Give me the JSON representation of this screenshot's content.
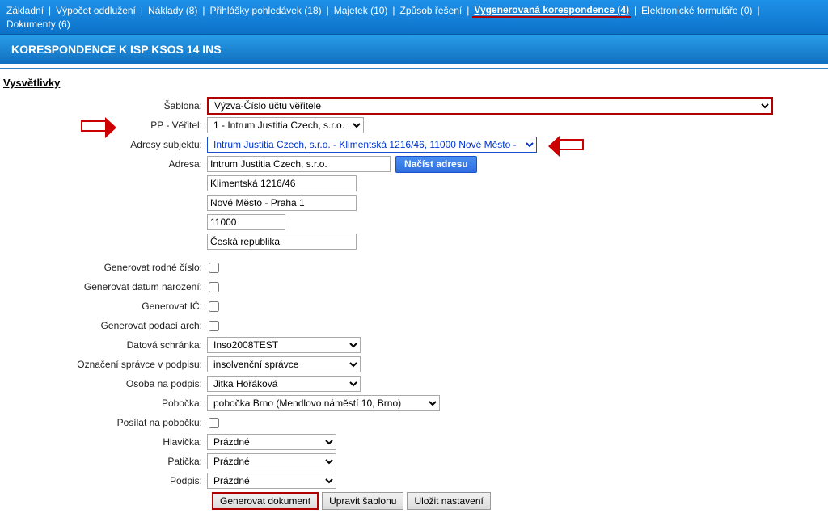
{
  "nav": {
    "items": [
      {
        "label": "Základní"
      },
      {
        "label": "Výpočet oddlužení"
      },
      {
        "label": "Náklady (8)"
      },
      {
        "label": "Přihlášky pohledávek (18)"
      },
      {
        "label": "Majetek (10)"
      },
      {
        "label": "Způsob řešení"
      },
      {
        "label": "Vygenerovaná korespondence (4)",
        "active": true
      },
      {
        "label": "Elektronické formuláře (0)"
      },
      {
        "label": "Dokumenty (6)"
      }
    ]
  },
  "header": {
    "title": "KORESPONDENCE K ISP KSOS 14 INS"
  },
  "lead": {
    "text": "Vysvětlivky"
  },
  "form": {
    "sablona": {
      "label": "Šablona:",
      "value": "Výzva-Číslo účtu věřitele"
    },
    "veritel": {
      "label": "PP - Věřitel:",
      "value": "1 - Intrum Justitia Czech, s.r.o."
    },
    "adresySubjektu": {
      "label": "Adresy subjektu:",
      "value": "Intrum Justitia Czech, s.r.o. - Klimentská 1216/46, 11000 Nové Město -"
    },
    "adresa": {
      "label": "Adresa:",
      "line1": "Intrum Justitia Czech, s.r.o.",
      "line2": "Klimentská 1216/46",
      "line3": "Nové Město - Praha 1",
      "line4": "11000",
      "line5": "Česká republika"
    },
    "btnNacist": "Načíst adresu",
    "genRodne": {
      "label": "Generovat rodné číslo:"
    },
    "genDatum": {
      "label": "Generovat datum narození:"
    },
    "genIc": {
      "label": "Generovat IČ:"
    },
    "genPodaci": {
      "label": "Generovat podací arch:"
    },
    "datschranka": {
      "label": "Datová schránka:",
      "value": "Inso2008TEST"
    },
    "oznSpravce": {
      "label": "Označení správce v podpisu:",
      "value": "insolvenční správce"
    },
    "osobaPodpis": {
      "label": "Osoba na podpis:",
      "value": "Jitka Hořáková"
    },
    "pobocka": {
      "label": "Pobočka:",
      "value": "pobočka Brno (Mendlovo náměstí 10, Brno)"
    },
    "posilat": {
      "label": "Posílat na pobočku:"
    },
    "hlavicka": {
      "label": "Hlavička:",
      "value": "Prázdné"
    },
    "paticka": {
      "label": "Patička:",
      "value": "Prázdné"
    },
    "podpis": {
      "label": "Podpis:",
      "value": "Prázdné"
    }
  },
  "buttons": {
    "generate": "Generovat dokument",
    "editTpl": "Upravit šablonu",
    "saveSet": "Uložit nastavení"
  }
}
